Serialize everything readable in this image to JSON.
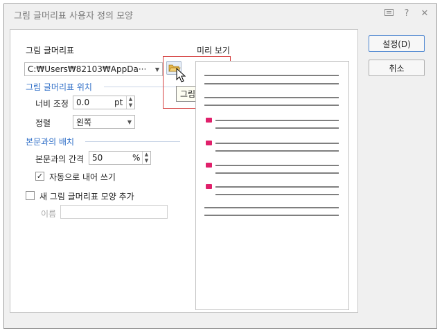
{
  "window": {
    "title": "그림 글머리표 사용자 정의 모양"
  },
  "picture_bullet": {
    "label": "그림 글머리표",
    "path_value": "C:₩Users₩82103₩AppDa···",
    "tooltip": "그림 선택..."
  },
  "position_section": {
    "label": "그림 글머리표 위치",
    "width_label": "너비 조정",
    "width_value": "0.0",
    "width_unit": "pt",
    "align_label": "정렬",
    "align_value": "왼쪽"
  },
  "layout_section": {
    "label": "본문과의 배치",
    "gap_label": "본문과의 간격",
    "gap_value": "50",
    "gap_unit": "%",
    "auto_indent_label": "자동으로 내어 쓰기",
    "auto_indent_checked": true
  },
  "new_shape": {
    "label": "새 그림 글머리표 모양 추가",
    "checked": false,
    "name_label": "이름",
    "name_value": ""
  },
  "preview": {
    "label": "미리 보기",
    "bullet_color": "#e0206b"
  },
  "buttons": {
    "ok": "설정(D)",
    "cancel": "취소"
  },
  "icons": [
    "help-icon",
    "question-icon",
    "close-icon",
    "folder-icon",
    "mouse-cursor-icon"
  ]
}
